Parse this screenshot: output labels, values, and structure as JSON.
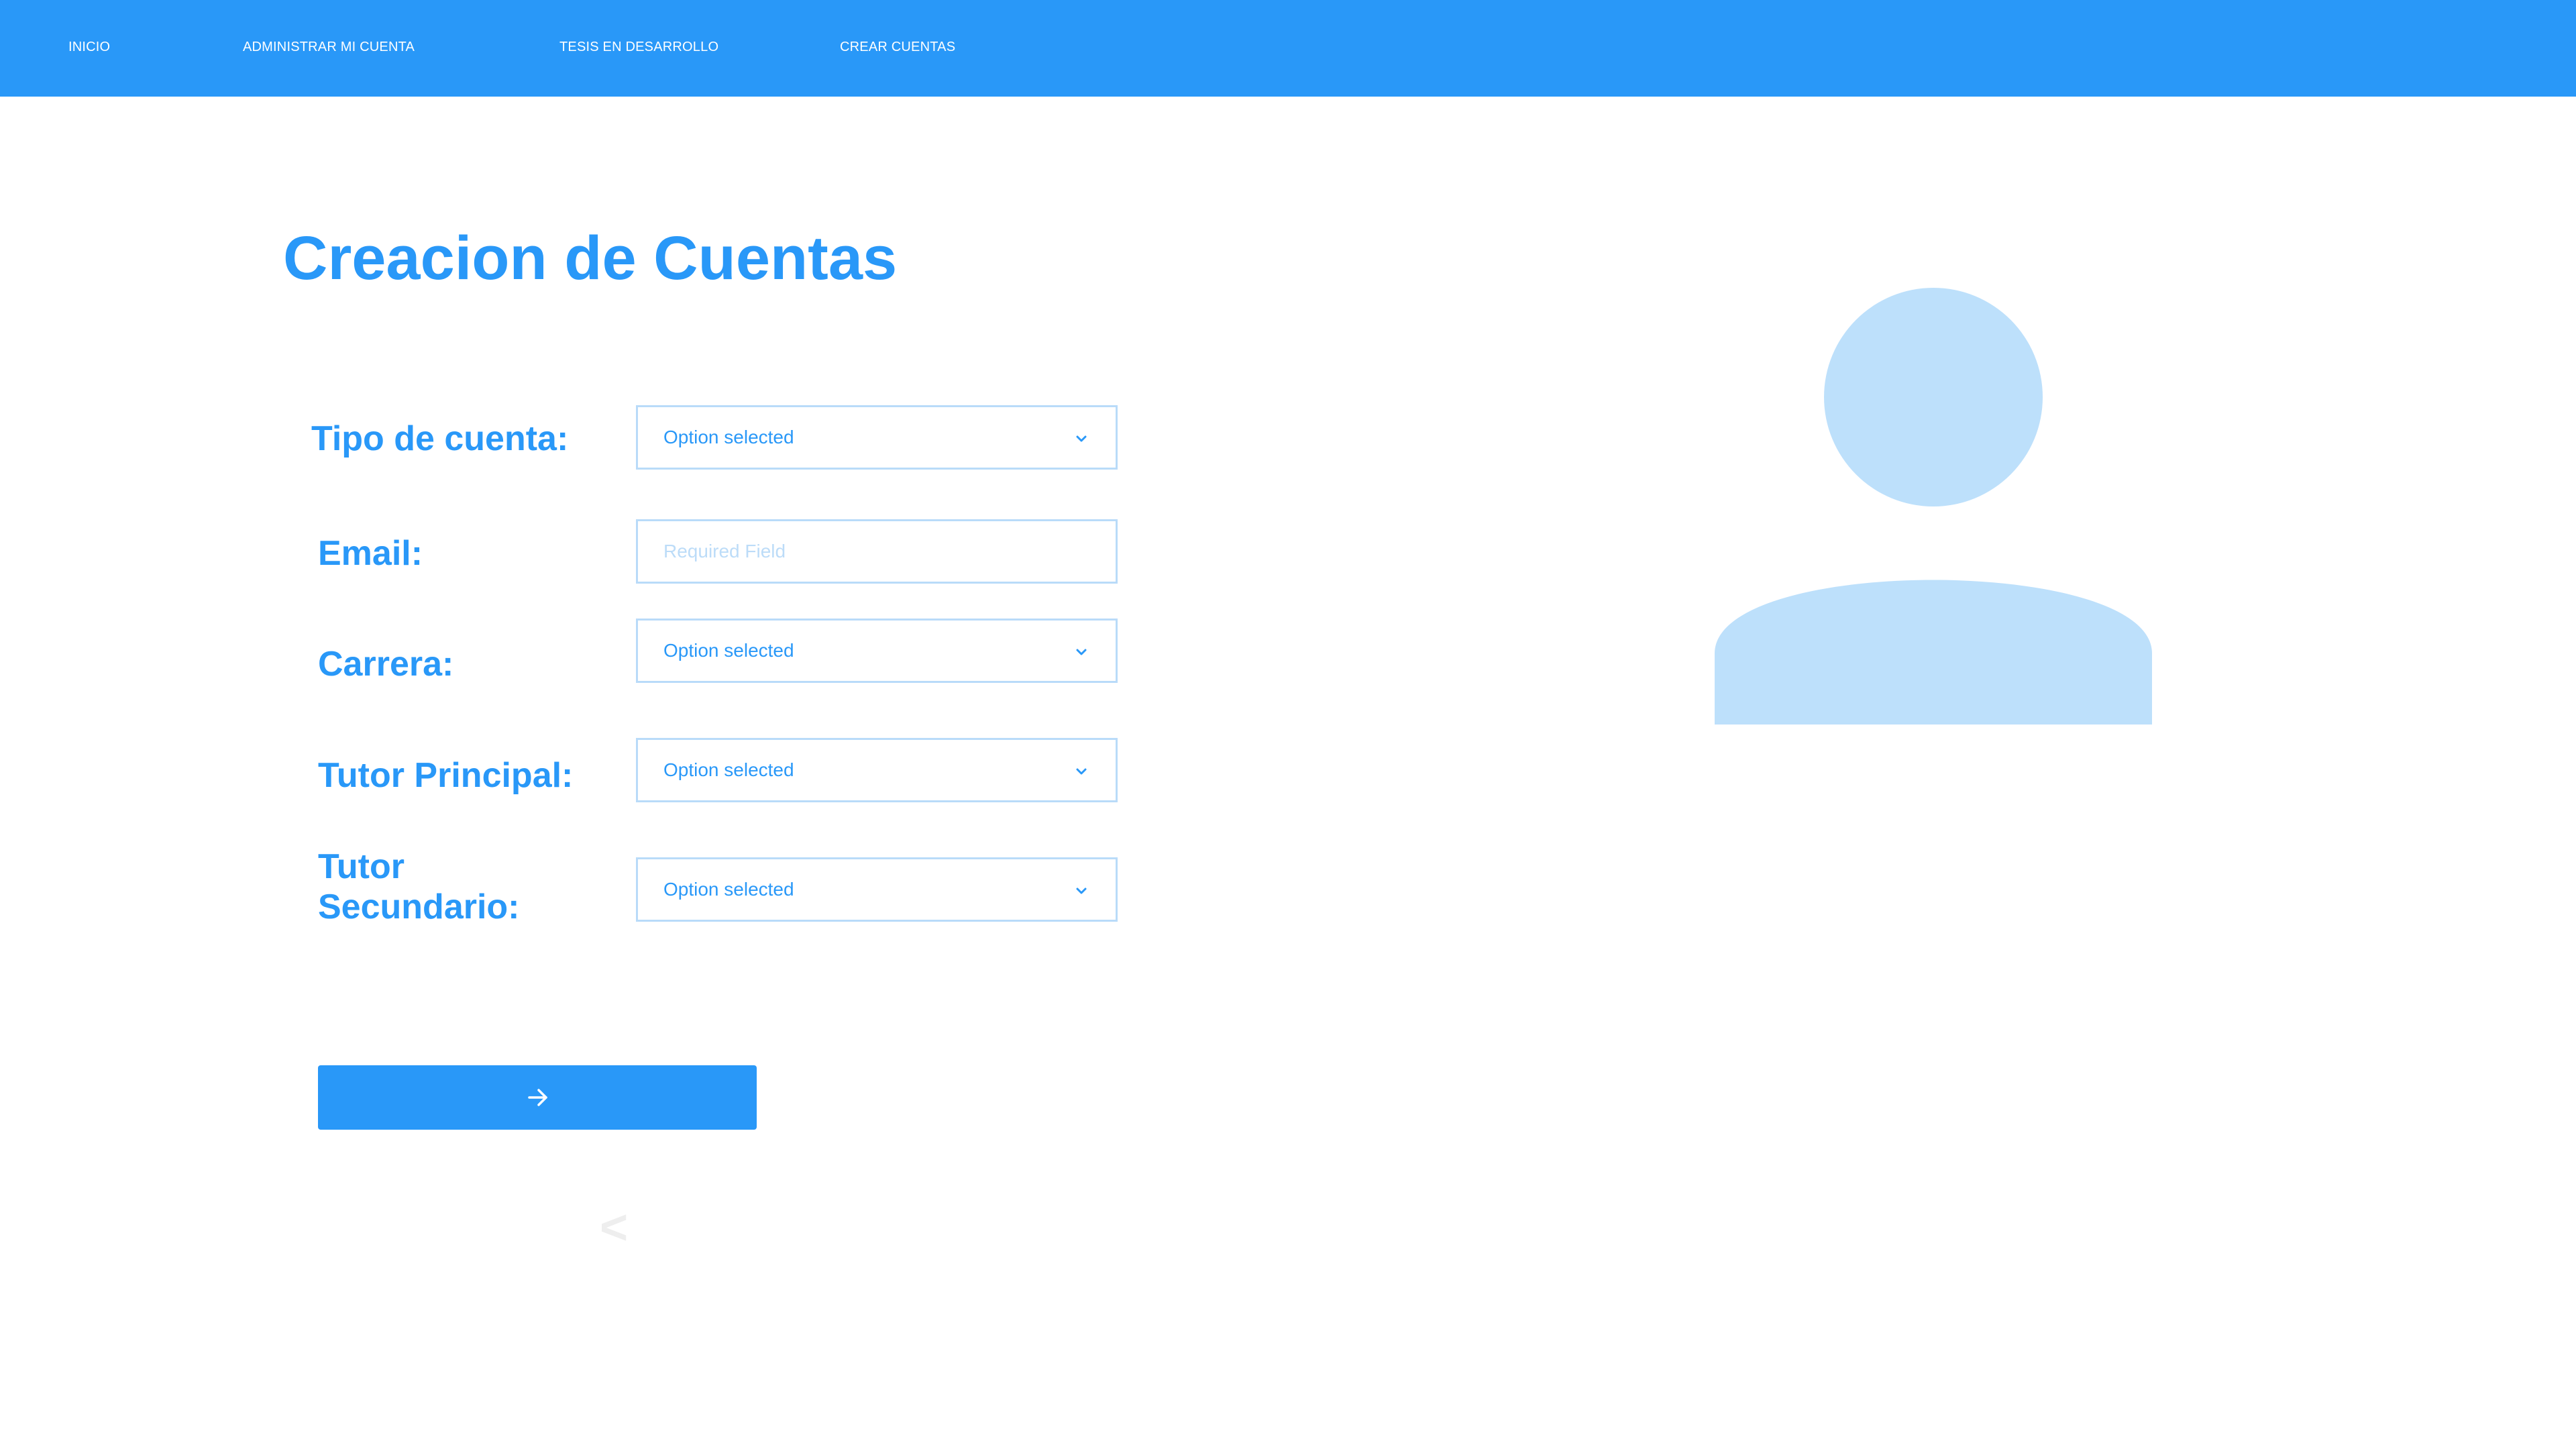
{
  "nav": {
    "items": [
      {
        "label": "INICIO"
      },
      {
        "label": "ADMINISTRAR MI CUENTA"
      },
      {
        "label": "TESIS EN DESARROLLO"
      },
      {
        "label": "CREAR CUENTAS"
      }
    ]
  },
  "page": {
    "title": "Creacion de Cuentas"
  },
  "form": {
    "account_type": {
      "label": "Tipo de cuenta:",
      "value": "Option selected"
    },
    "email": {
      "label": "Email:",
      "placeholder": "Required Field"
    },
    "career": {
      "label": "Carrera:",
      "value": "Option selected"
    },
    "main_tutor": {
      "label": "Tutor Principal:",
      "value": "Option selected"
    },
    "secondary_tutor": {
      "label_line1": "Tutor",
      "label_line2": "Secundario:",
      "value": "Option selected"
    },
    "submit_icon": "arrow-right-icon",
    "back_label": "<"
  },
  "avatar": {
    "icon": "user-placeholder-icon",
    "color": "#bde0fb"
  },
  "colors": {
    "primary": "#2998f8",
    "field_border": "#b9dbf9",
    "placeholder": "#bcdcf8",
    "background": "#ffffff"
  }
}
